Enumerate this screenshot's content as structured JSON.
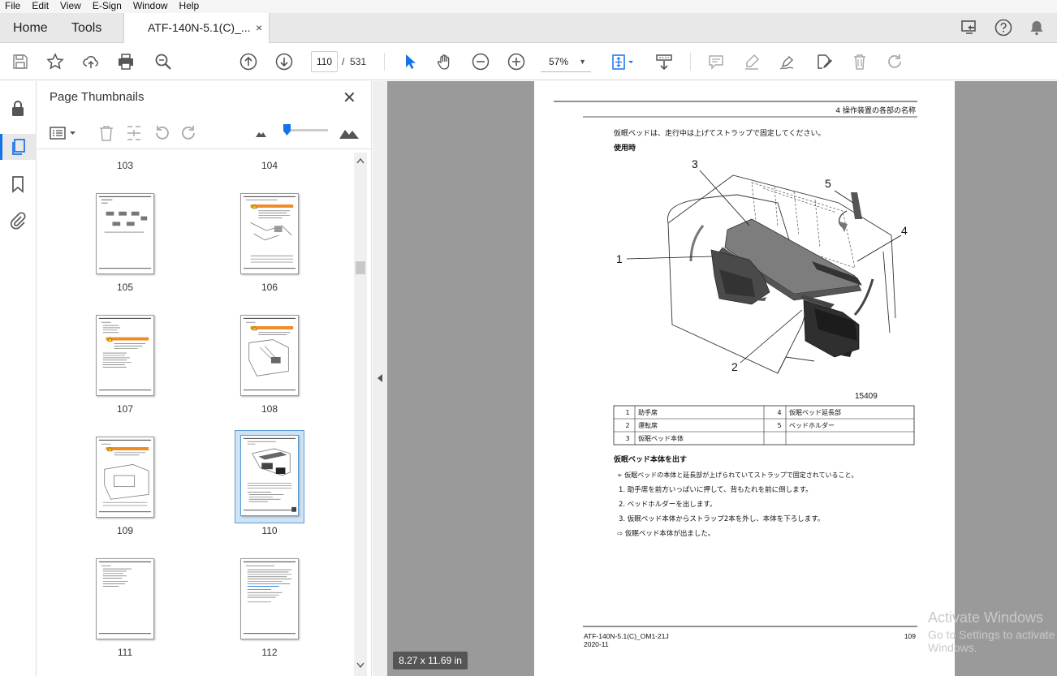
{
  "menu": [
    "File",
    "Edit",
    "View",
    "E-Sign",
    "Window",
    "Help"
  ],
  "tabs": {
    "home": "Home",
    "tools": "Tools",
    "document": "ATF-140N-5.1(C)_...",
    "close": "×"
  },
  "toolbar": {
    "page_current": "110",
    "page_sep": "/",
    "page_total": "531",
    "zoom": "57%"
  },
  "panel": {
    "title": "Page Thumbnails",
    "close": "✕",
    "thumbnails": [
      "103",
      "104",
      "105",
      "106",
      "107",
      "108",
      "109",
      "110",
      "111",
      "112"
    ],
    "selected": "110"
  },
  "document": {
    "header_right": "4 操作装置の各部の名称",
    "intro": "仮眠ベッドは、走行中は上げてストラップで固定してください。",
    "usage_heading": "使用時",
    "callouts": [
      "1",
      "2",
      "3",
      "4",
      "5"
    ],
    "figure_id": "15409",
    "legend": [
      [
        "1",
        "助手席",
        "4",
        "仮眠ベッド延長部"
      ],
      [
        "2",
        "運転席",
        "5",
        "ベッドホルダー"
      ],
      [
        "3",
        "仮眠ベッド本体",
        "",
        ""
      ]
    ],
    "section_heading": "仮眠ベッド本体を出す",
    "precondition": "仮眠ベッドの本体と延長部が上げられていてストラップで固定されていること。",
    "steps": [
      "1. 助手席を前方いっぱいに押して、背もたれを前に倒します。",
      "2. ベッドホルダーを出します。",
      "3. 仮眠ベッド本体からストラップ2本を外し、本体を下ろします。"
    ],
    "result": "仮眠ベッド本体が出ました。",
    "footer_left_1": "ATF-140N-5.1(C)_OM1-21J",
    "footer_left_2": "2020-11",
    "footer_page": "109"
  },
  "status": {
    "page_size": "8.27 x 11.69 in"
  },
  "watermark": {
    "line1": "Activate Windows",
    "line2": "Go to Settings to activate Windows."
  },
  "colors": {
    "accent": "#1473e6",
    "viewer_bg": "#9a9a9a",
    "selection": "#cfe3f5"
  }
}
